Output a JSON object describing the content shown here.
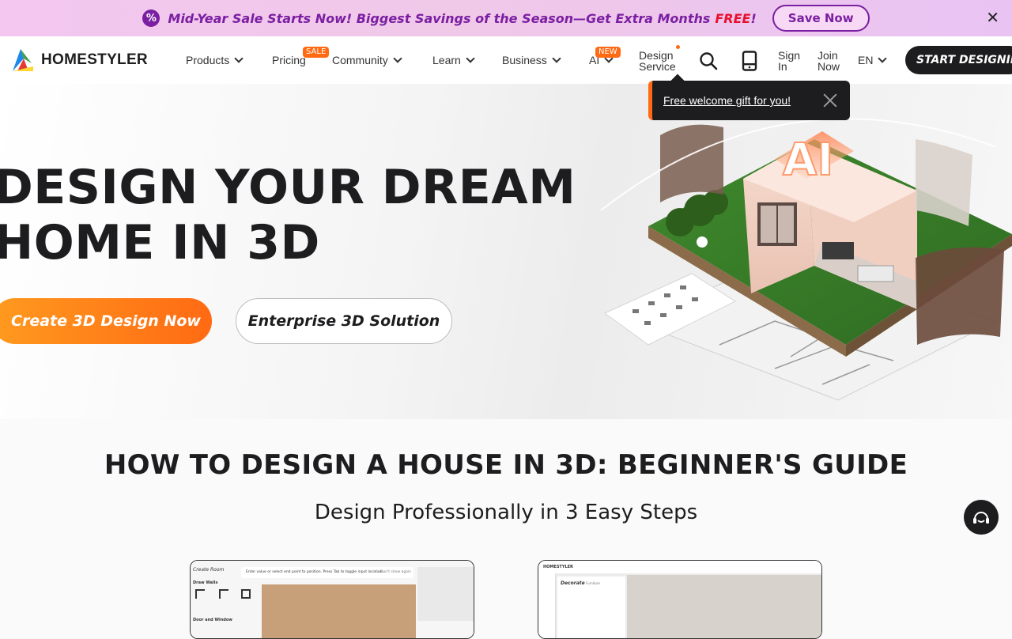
{
  "promo": {
    "message": "Mid-Year Sale Starts Now! Biggest Savings of the Season—Get Extra Months",
    "free": "FREE",
    "exclaim": "!",
    "save_label": "Save Now",
    "close": "✕"
  },
  "nav": {
    "brand": "HOMESTYLER",
    "products": "Products",
    "pricing": "Pricing",
    "pricing_badge": "SALE",
    "community": "Community",
    "learn": "Learn",
    "business": "Business",
    "ai": "AI",
    "ai_badge": "NEW",
    "design_service_1": "Design",
    "design_service_2": "Service",
    "sign_in_1": "Sign",
    "sign_in_2": "In",
    "join_1": "Join",
    "join_2": "Now",
    "language": "EN",
    "start_label": "START DESIGNING"
  },
  "gift": {
    "text": "Free welcome gift for you!"
  },
  "hero": {
    "title_line1": "DESIGN YOUR DREAM",
    "title_line2": "HOME IN 3D",
    "cta_primary": "Create 3D Design Now",
    "cta_secondary": "Enterprise 3D Solution",
    "house_sign": "AI"
  },
  "guide": {
    "title": "HOW TO DESIGN A HOUSE IN 3D: BEGINNER'S GUIDE",
    "subtitle": "Design Professionally in 3 Easy Steps",
    "shot1_title": "Create Room",
    "shot1_hint": "Enter value or select end point to position. Press Tab to toggle input location.",
    "shot1_dismiss": "Don't show again",
    "shot1_walls": "Draw Walls",
    "shot1_door": "Door and Window",
    "shot2_brand": "HOMESTYLER",
    "shot2_panel": "Decorate",
    "shot2_sub": "Furniture"
  },
  "colors": {
    "accent": "#ff6a13",
    "promo_purple": "#7a1fa2",
    "dark": "#1d1d1f"
  }
}
